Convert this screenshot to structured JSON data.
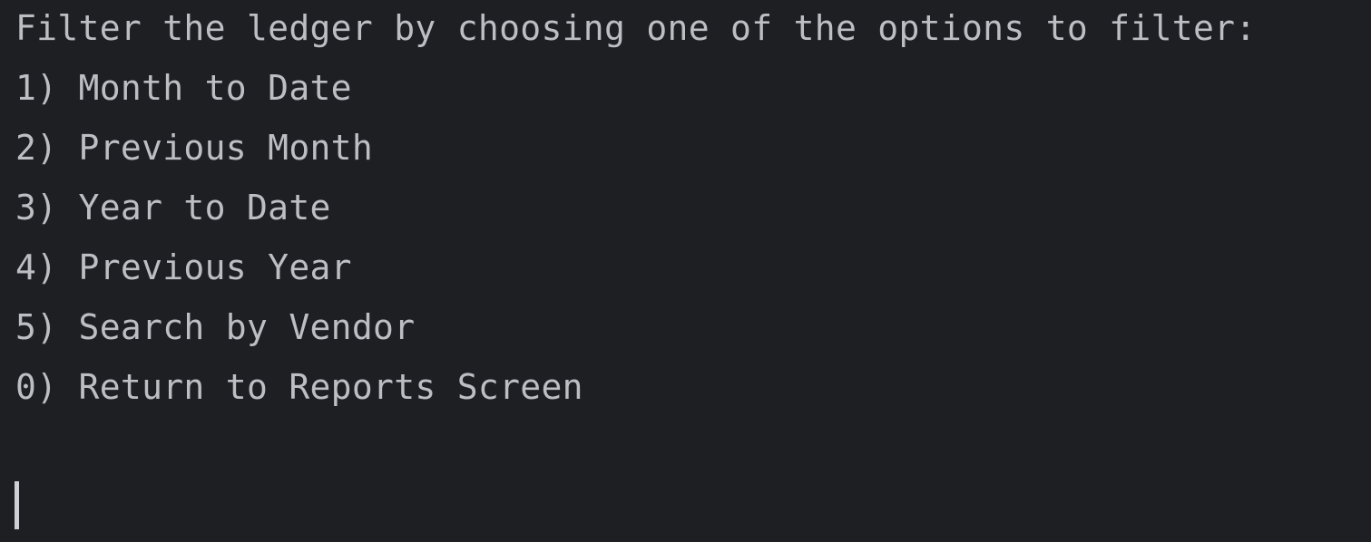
{
  "console": {
    "prompt": "Filter the ledger by choosing one of the options to filter:",
    "options": [
      {
        "label": "1) Month to Date"
      },
      {
        "label": "2) Previous Month"
      },
      {
        "label": "3) Year to Date"
      },
      {
        "label": "4) Previous Year"
      },
      {
        "label": "5) Search by Vendor"
      },
      {
        "label": "0) Return to Reports Screen"
      }
    ]
  },
  "colors": {
    "background": "#1e1f22",
    "text": "#bcbec4",
    "caret": "#ced0d6"
  }
}
